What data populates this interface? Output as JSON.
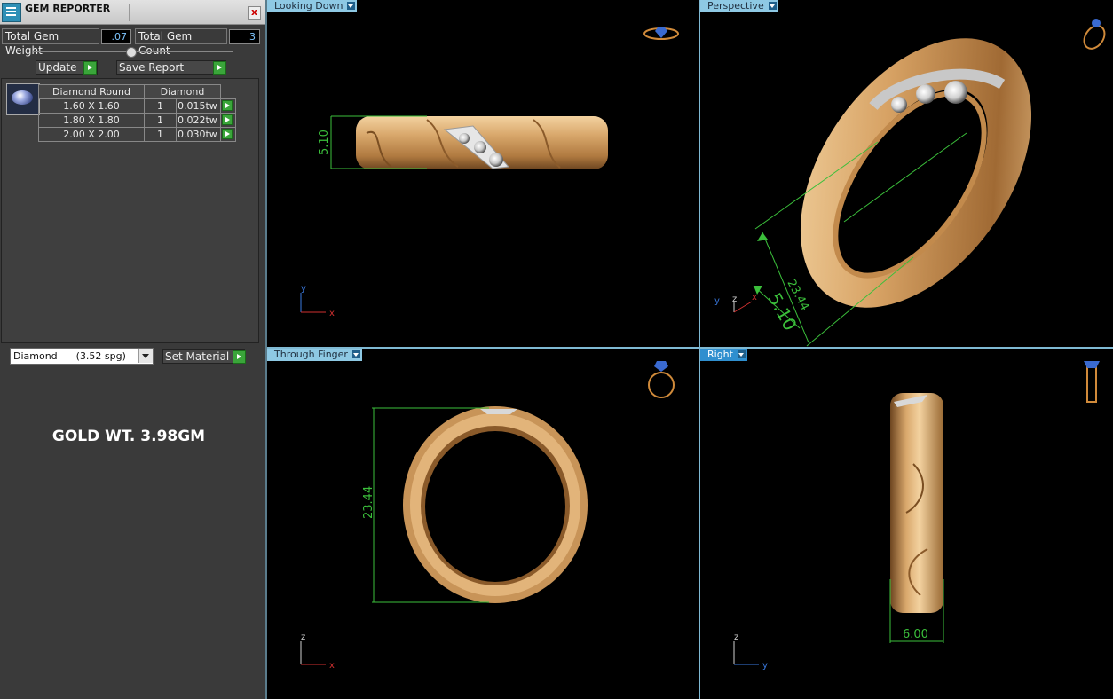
{
  "panel": {
    "title": "GEM REPORTER",
    "close_label": "x",
    "total_gem_weight_label": "Total Gem Weight",
    "total_gem_weight_value": ".07",
    "total_gem_count_label": "Total Gem Count",
    "total_gem_count_value": "3",
    "update_label": "Update",
    "save_report_label": "Save Report",
    "gem_table": {
      "headers": [
        "Diamond Round",
        "Diamond"
      ],
      "rows": [
        {
          "size": "1.60 X 1.60",
          "qty": "1",
          "weight": "0.015tw"
        },
        {
          "size": "1.80 X 1.80",
          "qty": "1",
          "weight": "0.022tw"
        },
        {
          "size": "2.00 X 2.00",
          "qty": "1",
          "weight": "0.030tw"
        }
      ]
    },
    "material_select": "Diamond      (3.52 spg)",
    "set_material_label": "Set Material",
    "gold_weight_text": "GOLD WT. 3.98GM"
  },
  "viewports": {
    "top_left": {
      "label": "Looking Down",
      "dimension": "5.10",
      "axes": [
        "y",
        "x"
      ]
    },
    "top_right": {
      "label": "Perspective",
      "dimensions": [
        "5.10",
        "23.44"
      ],
      "axes": [
        "y",
        "z",
        "x"
      ]
    },
    "bottom_left": {
      "label": "Through Finger",
      "dimension": "23.44",
      "axes": [
        "z",
        "x"
      ]
    },
    "bottom_right": {
      "label": "Right",
      "dimension": "6.00",
      "axes": [
        "z",
        "y"
      ],
      "active": true
    }
  },
  "colors": {
    "gold": "#d9a86c",
    "gold_shadow": "#8a5a2a",
    "dimension": "#3bbf3b",
    "viewport_tab": "#8ec9e4",
    "viewport_tab_active": "#2f8fcf"
  }
}
